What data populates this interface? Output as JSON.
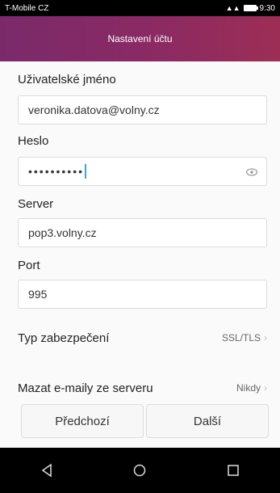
{
  "status_bar": {
    "carrier": "T-Mobile CZ",
    "time": "9:30"
  },
  "title": "Nastavení účtu",
  "form": {
    "username_label": "Uživatelské jméno",
    "username_value": "veronika.datova@volny.cz",
    "password_label": "Heslo",
    "password_value": "••••••••••",
    "server_label": "Server",
    "server_value": "pop3.volny.cz",
    "port_label": "Port",
    "port_value": "995",
    "security_label": "Typ zabezpečení",
    "security_value": "SSL/TLS",
    "delete_label": "Mazat e-maily ze serveru",
    "delete_value": "Nikdy"
  },
  "buttons": {
    "prev": "Předchozí",
    "next": "Další"
  },
  "icons": {
    "show_password": "eye-icon",
    "back": "back-icon",
    "home": "home-icon",
    "recents": "recents-icon"
  },
  "colors": {
    "title_gradient_start": "#7a2a6a",
    "title_gradient_end": "#9c2e55",
    "cursor": "#3ba3e8"
  }
}
